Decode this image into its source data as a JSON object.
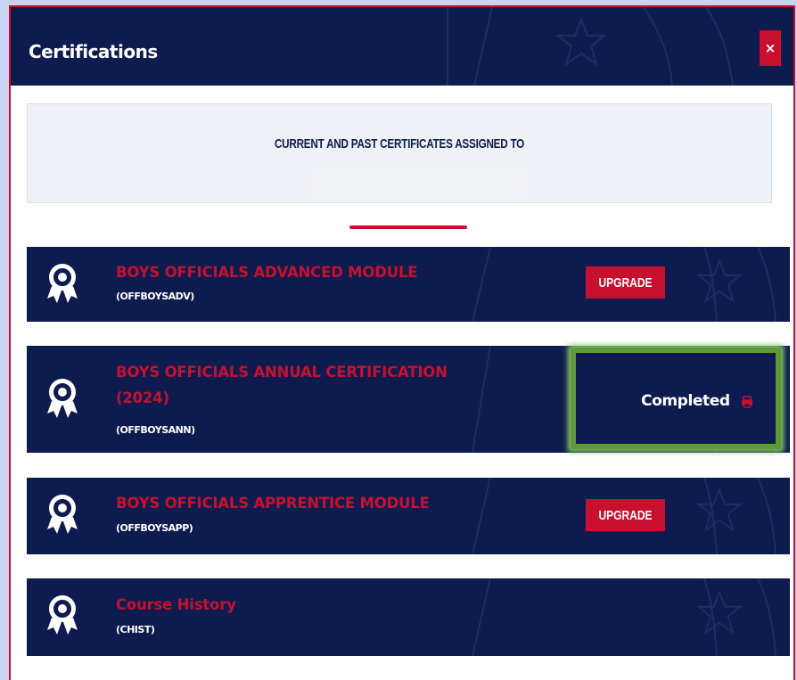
{
  "modal": {
    "title": "Certifications",
    "close_label": "×"
  },
  "intro": {
    "text": "CURRENT AND PAST CERTIFICATES ASSIGNED TO"
  },
  "certifications": [
    {
      "title_line1": "BOYS OFFICIALS ADVANCED MODULE",
      "title_line2": "",
      "code": "(OFFBOYSADV)",
      "action_label": "UPGRADE",
      "icon": "award-ribbon-icon"
    },
    {
      "title_line1": "BOYS OFFICIALS ANNUAL CERTIFICATION",
      "title_line2": "(2024)",
      "code": "(OFFBOYSANN)",
      "status_label": "Completed",
      "icon": "award-ribbon-icon",
      "status_icon": "print-icon"
    },
    {
      "title_line1": "BOYS OFFICIALS APPRENTICE MODULE",
      "title_line2": "",
      "code": "(OFFBOYSAPP)",
      "action_label": "UPGRADE",
      "icon": "award-ribbon-icon"
    },
    {
      "title_line1": "Course History",
      "title_line2": "",
      "code": "(CHIST)",
      "icon": "award-ribbon-icon"
    }
  ],
  "colors": {
    "navy": "#0d1b4f",
    "red": "#c8102e",
    "highlight_green": "#5f9a3a",
    "page_bg": "#c9d3f3"
  }
}
